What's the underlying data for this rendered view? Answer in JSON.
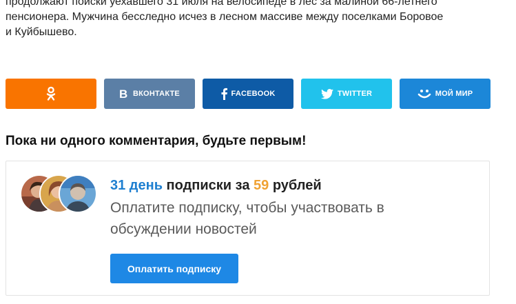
{
  "article": {
    "lines": [
      "продолжают поиски уехавшего 31 июля на велосипеде в лес за малиной 66-летнего",
      "пенсионера. Мужчина бесследно исчез в лесном массиве между поселками Боровое",
      "и Куйбышево."
    ]
  },
  "share": {
    "buttons": [
      {
        "id": "ok",
        "label": "",
        "icon": "odnoklassniki-icon",
        "color": "#f97400"
      },
      {
        "id": "vk",
        "label": "ВКОНТАКТЕ",
        "icon": "vk-icon",
        "color": "#5b7fa6"
      },
      {
        "id": "fb",
        "label": "FACEBOOK",
        "icon": "facebook-icon",
        "color": "#0e5ba6"
      },
      {
        "id": "tw",
        "label": "TWITTER",
        "icon": "twitter-icon",
        "color": "#21c2ec"
      },
      {
        "id": "mm",
        "label": "МОЙ МИР",
        "icon": "moimir-icon",
        "color": "#1c87d8"
      }
    ]
  },
  "comments": {
    "heading": "Пока ни одного комментария, будьте первым!"
  },
  "promo": {
    "title_days": "31 день",
    "title_middle": " подписки за ",
    "title_price": "59",
    "title_end": " рублей",
    "desc_line1": "Оплатите подписку, чтобы участвовать в",
    "desc_line2": "обсуждении новостей",
    "button_label": "Оплатить подписку",
    "colors": {
      "days": "#1e7fd0",
      "price": "#f0a233",
      "button": "#1e88e5"
    }
  }
}
